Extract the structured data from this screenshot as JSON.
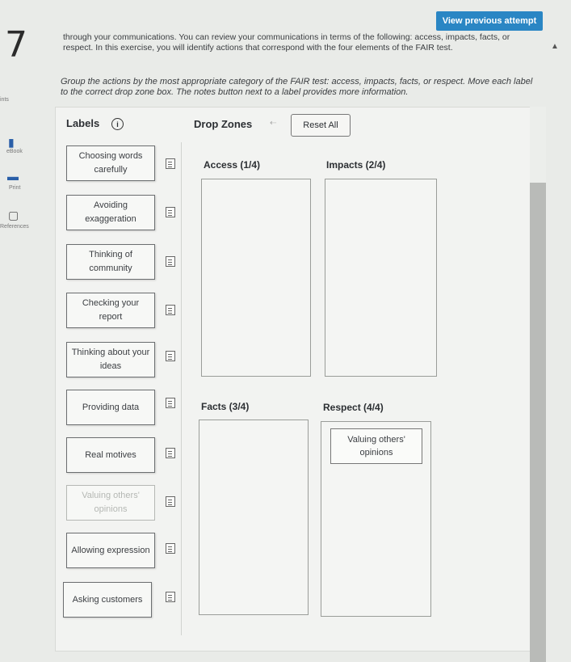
{
  "question_number": "7",
  "view_previous_label": "View previous attempt",
  "intro_text": "through your communications. You can review your communications in terms of the following: access, impacts, facts, or respect. In this exercise, you will identify actions that correspond with the four elements of the FAIR test.",
  "instructions": "Group the actions by the most appropriate category of the FAIR test: access, impacts, facts, or respect. Move each label to the correct drop zone box. The notes button next to a label provides more information.",
  "sidebar": {
    "hints": "ints",
    "ebook": "eBook",
    "print": "Print",
    "references": "References"
  },
  "labels_title": "Labels",
  "info_icon_glyph": "i",
  "drop_zones_title": "Drop Zones",
  "reset_label": "Reset All",
  "labels": [
    {
      "text": "Choosing words carefully"
    },
    {
      "text": "Avoiding exaggeration"
    },
    {
      "text": "Thinking of community"
    },
    {
      "text": "Checking your report"
    },
    {
      "text": "Thinking about your ideas"
    },
    {
      "text": "Providing data"
    },
    {
      "text": "Real motives"
    },
    {
      "text": "Valuing others' opinions"
    },
    {
      "text": "Allowing expression"
    },
    {
      "text": "Asking customers"
    }
  ],
  "zones": {
    "access": "Access (1/4)",
    "impacts": "Impacts (2/4)",
    "facts": "Facts (3/4)",
    "respect": "Respect (4/4)"
  },
  "placed": {
    "respect_item": "Valuing others' opinions"
  }
}
